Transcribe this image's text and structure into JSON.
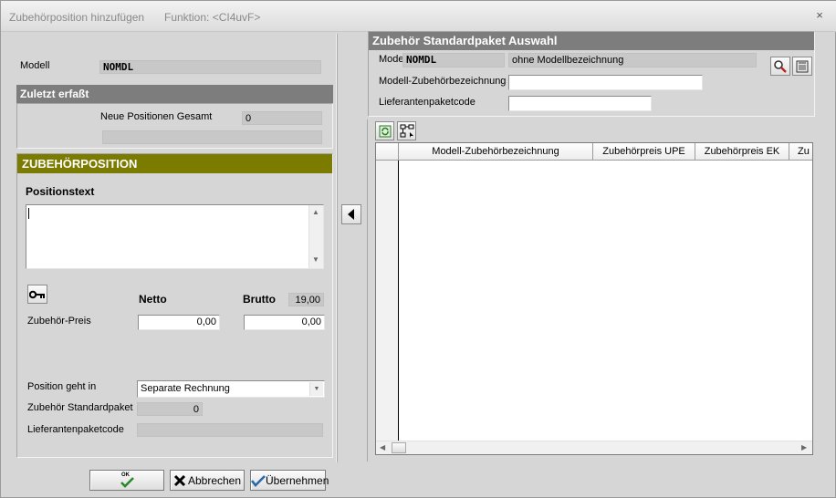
{
  "window": {
    "title": "Zubehörposition hinzufügen",
    "function_label": "Funktion: <CI4uvF>",
    "close_symbol": "×"
  },
  "left": {
    "modell_label": "Modell",
    "modell_value": "NOMDL",
    "zuletzt": {
      "header": "Zuletzt erfaßt",
      "neue_positionen_label": "Neue Positionen Gesamt",
      "neue_positionen_value": "0"
    },
    "zubehoerposition": {
      "header": "ZUBEHÖRPOSITION",
      "positionstext_label": "Positionstext",
      "positionstext_value": "",
      "netto_label": "Netto",
      "brutto_label": "Brutto",
      "mwst_value": "19,00",
      "preis_label": "Zubehör-Preis",
      "netto_value": "0,00",
      "brutto_value": "0,00",
      "position_geht_in_label": "Position geht in",
      "position_geht_in_value": "Separate Rechnung",
      "standardpaket_label": "Zubehör Standardpaket",
      "standardpaket_value": "0",
      "lieferantenpaketcode_label": "Lieferantenpaketcode",
      "lieferantenpaketcode_value": ""
    }
  },
  "right": {
    "header": "Zubehör Standardpaket Auswahl",
    "modell_label": "Modell",
    "modell_value": "NOMDL",
    "modell_desc": "ohne Modellbezeichnung",
    "bezeichnung_label": "Modell-Zubehörbezeichnung",
    "bezeichnung_value": "",
    "lieferantenpaketcode_label": "Lieferantenpaketcode",
    "lieferantenpaketcode_value": "",
    "grid_columns": [
      "Modell-Zubehörbezeichnung",
      "Zubehörpreis UPE",
      "Zubehörpreis EK",
      "Zu"
    ]
  },
  "footer": {
    "ok_label": "OK",
    "abbrechen_label": "Abbrechen",
    "uebernehmen_label": "Übernehmen"
  },
  "colors": {
    "grey_header": "#7d7d7d",
    "olive_header": "#7b7b00",
    "ok_check": "#2a8a2a"
  },
  "icons": [
    "close-icon",
    "key-icon",
    "dropdown-arrow-icon",
    "transfer-left-icon",
    "refresh-icon",
    "tree-icon",
    "search-icon",
    "clear-icon",
    "check-icon",
    "cross-icon"
  ]
}
